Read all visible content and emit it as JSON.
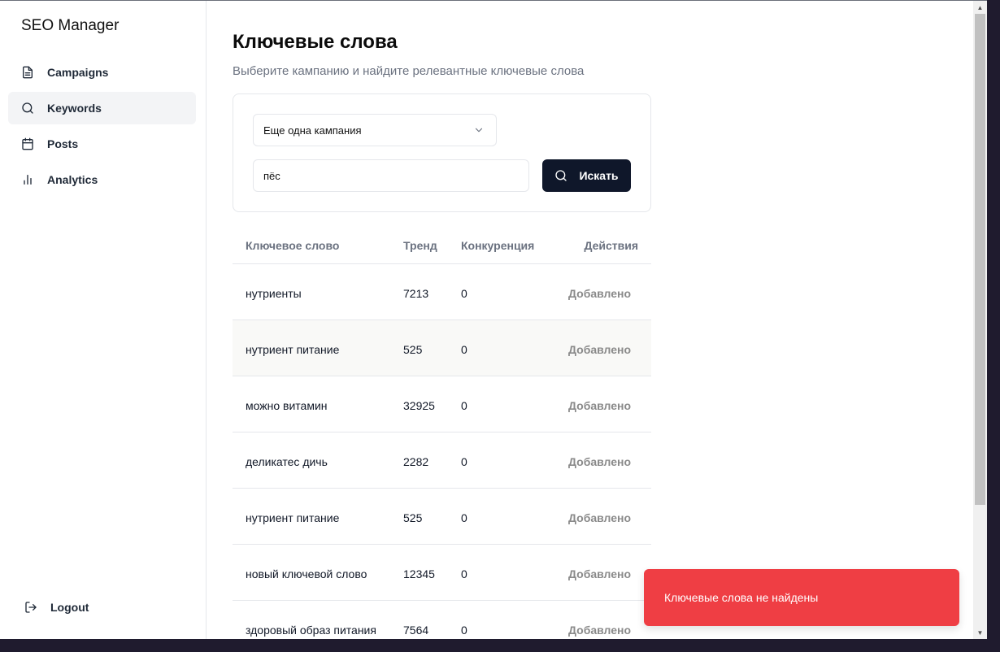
{
  "app": {
    "title": "SEO Manager"
  },
  "sidebar": {
    "items": [
      {
        "label": "Campaigns",
        "icon": "document-icon"
      },
      {
        "label": "Keywords",
        "icon": "search-icon",
        "active": true
      },
      {
        "label": "Posts",
        "icon": "calendar-icon"
      },
      {
        "label": "Analytics",
        "icon": "bar-chart-icon"
      }
    ],
    "logout_label": "Logout"
  },
  "page": {
    "title": "Ключевые слова",
    "subtitle": "Выберите кампанию и найдите релевантные ключевые слова"
  },
  "search": {
    "campaign_selected": "Еще одна кампания",
    "query": "пёс",
    "button_label": "Искать"
  },
  "table": {
    "headers": [
      "Ключевое слово",
      "Тренд",
      "Конкуренция",
      "Действия"
    ],
    "rows": [
      {
        "keyword": "нутриенты",
        "trend": "7213",
        "competition": "0",
        "action": "Добавлено"
      },
      {
        "keyword": "нутриент питание",
        "trend": "525",
        "competition": "0",
        "action": "Добавлено"
      },
      {
        "keyword": "можно витамин",
        "trend": "32925",
        "competition": "0",
        "action": "Добавлено"
      },
      {
        "keyword": "деликатес дичь",
        "trend": "2282",
        "competition": "0",
        "action": "Добавлено"
      },
      {
        "keyword": "нутриент питание",
        "trend": "525",
        "competition": "0",
        "action": "Добавлено"
      },
      {
        "keyword": "новый ключевой слово",
        "trend": "12345",
        "competition": "0",
        "action": "Добавлено"
      },
      {
        "keyword": "здоровый образ питания",
        "trend": "7564",
        "competition": "0",
        "action": "Добавлено"
      }
    ]
  },
  "toast": {
    "message": "Ключевые слова не найдены",
    "color": "#ef3e44"
  },
  "colors": {
    "primary_button": "#0f172a",
    "active_nav_bg": "#f3f4f6"
  }
}
